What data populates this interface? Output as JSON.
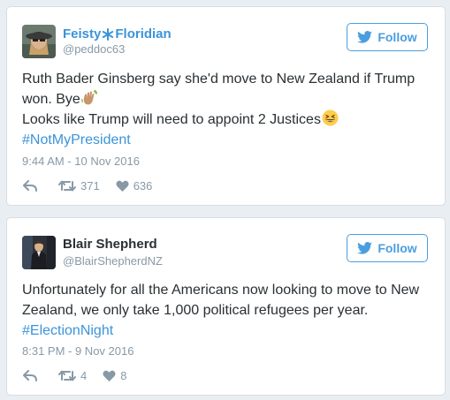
{
  "tweets": [
    {
      "display_name": "Feisty",
      "display_name_suffix": "Floridian",
      "handle": "@peddoc63",
      "follow_label": "Follow",
      "text_line1": "Ruth Bader Ginsberg say she'd move to New Zealand if Trump won. Bye",
      "text_line2": "Looks like Trump will need to appoint 2 Justices",
      "hashtag": "#NotMyPresident",
      "timestamp": "9:44 AM - 10 Nov 2016",
      "retweets": "371",
      "likes": "636"
    },
    {
      "display_name": "Blair Shepherd",
      "handle": "@BlairShepherdNZ",
      "follow_label": "Follow",
      "text_line1": "Unfortunately for all the Americans now looking to move to New Zealand, we only take 1,000 political refugees per year.",
      "hashtag": "#ElectionNight",
      "timestamp": "8:31 PM - 9 Nov 2016",
      "retweets": "4",
      "likes": "8"
    }
  ],
  "colors": {
    "accent": "#3b94d9",
    "follow_border": "#4a9ee0",
    "muted": "#8899a6",
    "text": "#292f33",
    "background": "#e9eef2"
  },
  "icons": {
    "reply": "reply-icon",
    "retweet": "retweet-icon",
    "like": "heart-icon",
    "follow": "twitter-bird-icon"
  }
}
